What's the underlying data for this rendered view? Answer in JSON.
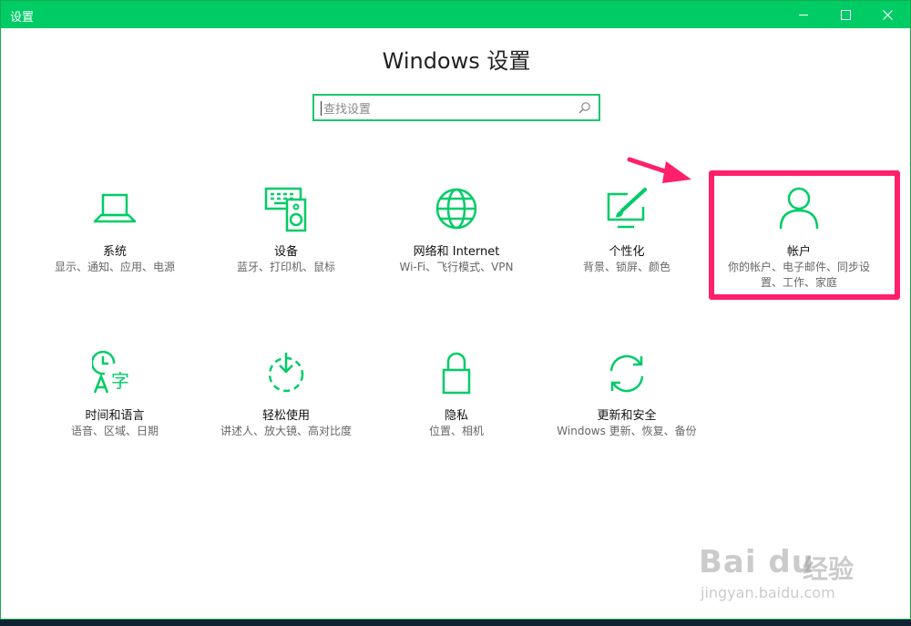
{
  "window": {
    "title": "设置",
    "controls": {
      "minimize": "minimize-icon",
      "maximize": "maximize-icon",
      "close": "close-icon"
    }
  },
  "page": {
    "heading": "Windows 设置"
  },
  "search": {
    "placeholder": "查找设置",
    "icon": "search-icon"
  },
  "accent_color": "#00cc66",
  "highlight_color": "#ff1f6a",
  "tiles": [
    {
      "name": "系统",
      "desc": "显示、通知、应用、电源",
      "icon": "laptop-icon"
    },
    {
      "name": "设备",
      "desc": "蓝牙、打印机、鼠标",
      "icon": "devices-icon"
    },
    {
      "name": "网络和 Internet",
      "desc": "Wi-Fi、飞行模式、VPN",
      "icon": "globe-icon"
    },
    {
      "name": "个性化",
      "desc": "背景、锁屏、颜色",
      "icon": "personalization-icon"
    },
    {
      "name": "帐户",
      "desc": "你的帐户、电子邮件、同步设置、工作、家庭",
      "icon": "person-icon"
    },
    {
      "name": "时间和语言",
      "desc": "语音、区域、日期",
      "icon": "time-language-icon"
    },
    {
      "name": "轻松使用",
      "desc": "讲述人、放大镜、高对比度",
      "icon": "ease-of-access-icon"
    },
    {
      "name": "隐私",
      "desc": "位置、相机",
      "icon": "lock-icon"
    },
    {
      "name": "更新和安全",
      "desc": "Windows 更新、恢复、备份",
      "icon": "sync-icon"
    }
  ],
  "watermark": {
    "brand": "Bai du",
    "jingyan": "经验",
    "url": "jingyan.baidu.com"
  }
}
